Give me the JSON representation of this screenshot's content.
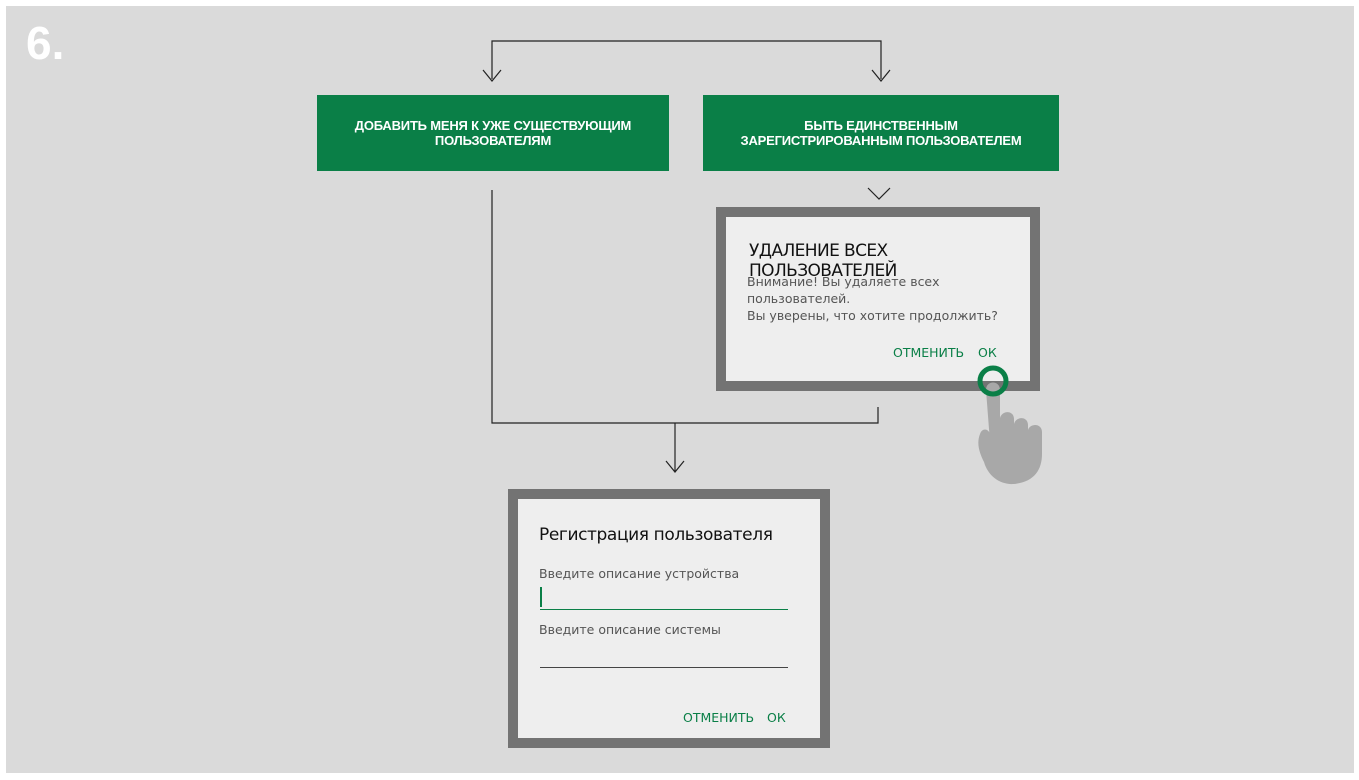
{
  "step": {
    "number": "6."
  },
  "options": {
    "left_label": "ДОБАВИТЬ МЕНЯ К УЖЕ СУЩЕСТВУЮЩИМ ПОЛЬЗОВАТЕЛЯМ",
    "right_label": "БЫТЬ ЕДИНСТВЕННЫМ ЗАРЕГИСТРИРОВАННЫМ ПОЛЬЗОВАТЕЛЕМ"
  },
  "delete_dialog": {
    "title": "УДАЛЕНИЕ ВСЕХ ПОЛЬЗОВАТЕЛЕЙ",
    "message_line1": "Внимание! Вы удаляете всех",
    "message_line2": "пользователей.",
    "message_line3": "Вы уверены, что хотите продолжить?",
    "cancel_label": "ОТМЕНИТЬ",
    "ok_label": "ОК"
  },
  "register_dialog": {
    "title": "Регистрация пользователя",
    "device_field_label": "Введите описание устройства",
    "device_field_value": "",
    "system_field_label": "Введите описание системы",
    "system_field_value": "",
    "cancel_label": "ОТМЕНИТЬ",
    "ok_label": "ОК"
  },
  "icons": {
    "tap_hand": "tap-hand-icon"
  },
  "colors": {
    "background": "#dadada",
    "accent_green": "#0a7f47",
    "dialog_border": "#737373",
    "dialog_body": "#eeeeee",
    "hand": "#a8a8a8"
  }
}
